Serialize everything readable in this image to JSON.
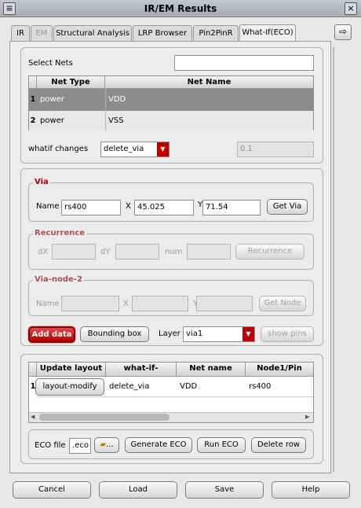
{
  "window": {
    "title": "IR/EM Results",
    "close_glyph": "×"
  },
  "tabs": [
    {
      "label": "IR",
      "enabled": true
    },
    {
      "label": "EM",
      "enabled": false
    },
    {
      "label": "Structural Analysis",
      "enabled": true
    },
    {
      "label": "LRP Browser",
      "enabled": true
    },
    {
      "label": "Pin2PinR",
      "enabled": true
    },
    {
      "label": "What-If(ECO)",
      "enabled": true,
      "active": true
    }
  ],
  "select_nets": {
    "label": "Select Nets",
    "value": ""
  },
  "net_table": {
    "headers": [
      "Net Type",
      "Net Name"
    ],
    "rows": [
      {
        "num": "1",
        "type": "power",
        "name": "VDD",
        "selected": true
      },
      {
        "num": "2",
        "type": "power",
        "name": "VSS",
        "selected": false
      }
    ]
  },
  "whatif": {
    "label": "whatif changes",
    "value": "delete_via",
    "numeric_value": "0.1"
  },
  "via": {
    "title": "Via",
    "name_label": "Name",
    "name_value": "rs400",
    "x_label": "X",
    "x_value": "45.025",
    "y_label": "Y",
    "y_value": "71.54",
    "button": "Get Via"
  },
  "recurrence": {
    "title": "Recurrence",
    "dx_label": "dX",
    "dy_label": "dY",
    "num_label": "num",
    "button": "Recurrence"
  },
  "via_node2": {
    "title": "Via-node-2",
    "name_label": "Name",
    "x_label": "X",
    "y_label": "Y",
    "button": "Get Node"
  },
  "actions": {
    "add_data": "Add data",
    "bounding_box": "Bounding box",
    "layer_label": "Layer",
    "layer_value": "via1",
    "show_pins": "show pins"
  },
  "eco_table": {
    "headers": [
      "Update layout",
      "what-if-analysis",
      "Net name",
      "Node1/Pin"
    ],
    "rows": [
      {
        "num": "1",
        "button": "layout-modify",
        "analysis": "delete_via",
        "net": "VDD",
        "node": "rs400"
      }
    ]
  },
  "eco": {
    "file_label": "ECO file",
    "file_value": ".eco",
    "browse": "...",
    "generate": "Generate ECO",
    "run": "Run ECO",
    "delete_row": "Delete row"
  },
  "footer": {
    "cancel": "Cancel",
    "load": "Load",
    "save": "Save",
    "help": "Help"
  }
}
